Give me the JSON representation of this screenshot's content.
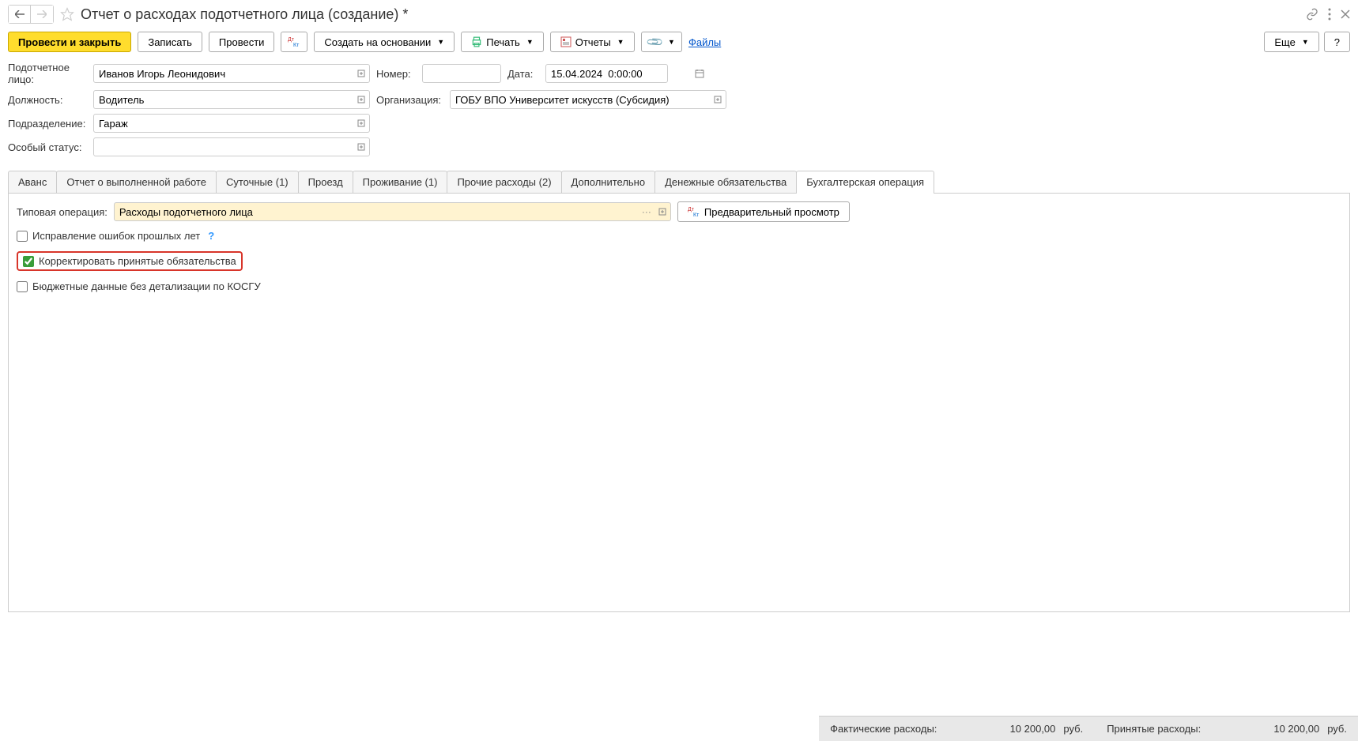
{
  "header": {
    "title": "Отчет о расходах подотчетного лица (создание) *"
  },
  "toolbar": {
    "post_close": "Провести и закрыть",
    "save": "Записать",
    "post": "Провести",
    "create_based": "Создать на основании",
    "print": "Печать",
    "reports": "Отчеты",
    "files": "Файлы",
    "more": "Еще",
    "help": "?"
  },
  "form": {
    "person_label": "Подотчетное лицо:",
    "person_value": "Иванов Игорь Леонидович",
    "number_label": "Номер:",
    "date_label": "Дата:",
    "date_value": "15.04.2024  0:00:00",
    "position_label": "Должность:",
    "position_value": "Водитель",
    "org_label": "Организация:",
    "org_value": "ГОБУ ВПО Университет искусств (Субсидия)",
    "department_label": "Подразделение:",
    "department_value": "Гараж",
    "status_label": "Особый статус:"
  },
  "tabs": [
    "Аванс",
    "Отчет о выполненной работе",
    "Суточные (1)",
    "Проезд",
    "Проживание (1)",
    "Прочие расходы (2)",
    "Дополнительно",
    "Денежные обязательства",
    "Бухгалтерская операция"
  ],
  "tab_content": {
    "op_label": "Типовая операция:",
    "op_value": "Расходы подотчетного лица",
    "preview_btn": "Предварительный просмотр",
    "cb1": "Исправление ошибок прошлых лет",
    "cb2": "Корректировать принятые обязательства",
    "cb3": "Бюджетные данные без детализации по КОСГУ"
  },
  "footer": {
    "actual_label": "Фактические расходы:",
    "actual_value": "10 200,00",
    "accepted_label": "Принятые расходы:",
    "accepted_value": "10 200,00",
    "unit": "руб."
  }
}
